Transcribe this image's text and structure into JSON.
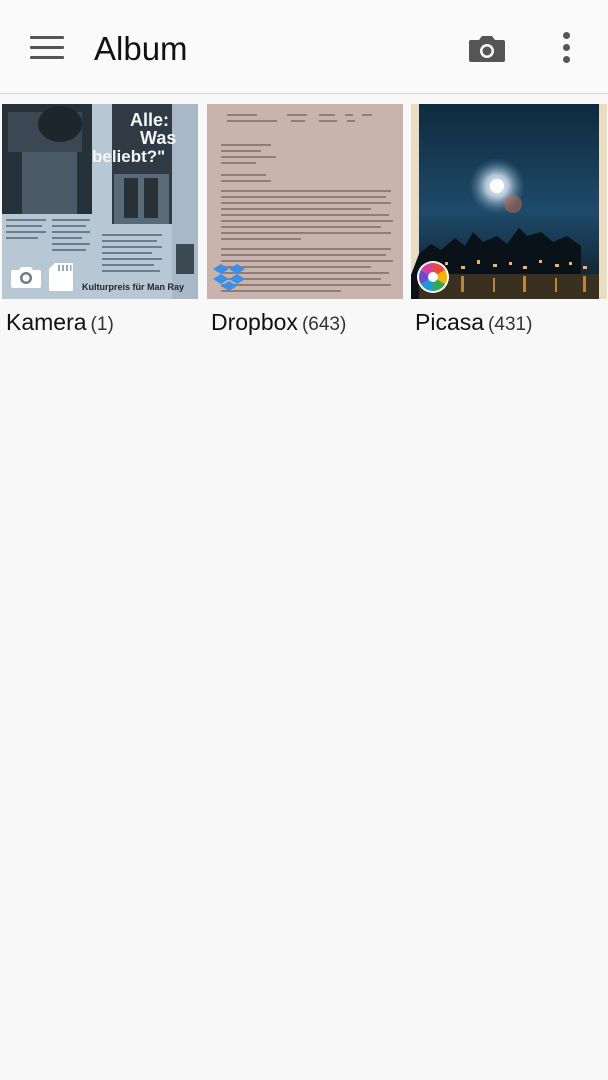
{
  "appbar": {
    "title": "Album",
    "menu_icon": "hamburger-menu-icon",
    "camera_icon": "camera-icon",
    "more_icon": "more-vert-icon"
  },
  "albums": [
    {
      "name": "Kamera",
      "count": "(1)",
      "badges": [
        "camera-icon",
        "sd-card-icon"
      ],
      "thumb_texts": [
        "Alle:",
        "Was",
        "beliebt?\"",
        "Kulturpreis für Man Ray"
      ]
    },
    {
      "name": "Dropbox",
      "count": "(643)",
      "badges": [
        "dropbox-icon"
      ]
    },
    {
      "name": "Picasa",
      "count": "(431)",
      "badges": [
        "picasa-icon"
      ]
    }
  ],
  "colors": {
    "background": "#f8f8f8",
    "appbar": "#fafafa",
    "icon_grey": "#555555",
    "dropbox_blue": "#3d8ee6"
  }
}
